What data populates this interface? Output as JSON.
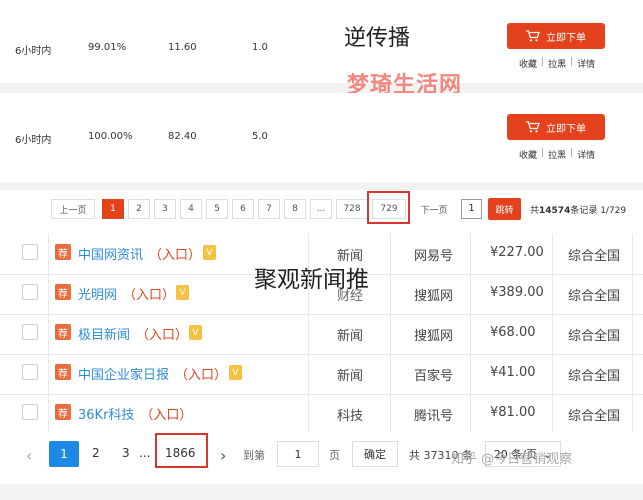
{
  "top": {
    "rows": [
      {
        "time": "6小时内",
        "rate": "99.01%",
        "price": "11.60",
        "score": "1.0"
      },
      {
        "time": "6小时内",
        "rate": "100.00%",
        "price": "82.40",
        "score": "5.0"
      }
    ],
    "buy_label": "立即下单",
    "links": [
      "收藏",
      "拉黑",
      "详情"
    ],
    "link_sep": "|",
    "overlay_title": "逆传播",
    "overlay_watermark": "梦琦生活网",
    "pager": {
      "prev": "上一页",
      "pages": [
        "1",
        "2",
        "3",
        "4",
        "5",
        "6",
        "7",
        "8",
        "...",
        "728",
        "729"
      ],
      "active_page": "1",
      "next": "下一页",
      "input_value": "1",
      "jump": "跳转",
      "total_prefix": "共",
      "total_count": "14574",
      "total_suffix": "条记录 1/729"
    }
  },
  "bottom": {
    "overlay_title": "聚观新闻推",
    "rec_badge": "荐",
    "entry_label": "（入口）",
    "v_badge": "V",
    "rows": [
      {
        "name": "中国网资讯",
        "category": "新闻",
        "platform": "网易号",
        "price": "¥227.00",
        "region": "综合全国",
        "verified": true
      },
      {
        "name": "光明网",
        "category": "财经",
        "platform": "搜狐网",
        "price": "¥389.00",
        "region": "综合全国",
        "verified": true
      },
      {
        "name": "极目新闻",
        "category": "新闻",
        "platform": "搜狐网",
        "price": "¥68.00",
        "region": "综合全国",
        "verified": true
      },
      {
        "name": "中国企业家日报",
        "category": "新闻",
        "platform": "百家号",
        "price": "¥41.00",
        "region": "综合全国",
        "verified": true
      },
      {
        "name": "36Kr科技",
        "category": "科技",
        "platform": "腾讯号",
        "price": "¥81.00",
        "region": "综合全国",
        "verified": false
      }
    ],
    "pager": {
      "prev_icon": "‹",
      "pages": [
        "1",
        "2",
        "3"
      ],
      "ellipsis": "...",
      "last_page": "1866",
      "next_icon": "›",
      "goto": "到第",
      "input_value": "1",
      "page_unit": "页",
      "confirm": "确定",
      "total": "共 37310 条",
      "page_size": "20 条/页",
      "dropdown_icon": "⌄"
    },
    "watermark": "知乎 @今日营销观察"
  },
  "colors": {
    "accent_red": "#e3421c",
    "link_blue": "#2e8cd6",
    "active_blue": "#1e88e5"
  }
}
